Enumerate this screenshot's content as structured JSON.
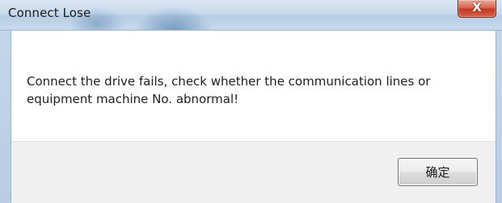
{
  "window": {
    "title": "Connect Lose",
    "close_glyph": "X"
  },
  "dialog": {
    "message": "Connect the drive fails, check whether the communication lines or equipment machine No. abnormal!",
    "ok_label": "确定"
  },
  "colors": {
    "titlebar": "#c7d9ec",
    "close_button": "#c0391f",
    "content_bg": "#ffffff",
    "button_bar_bg": "#f0f0f0"
  },
  "icons": {
    "close": "close-icon"
  }
}
